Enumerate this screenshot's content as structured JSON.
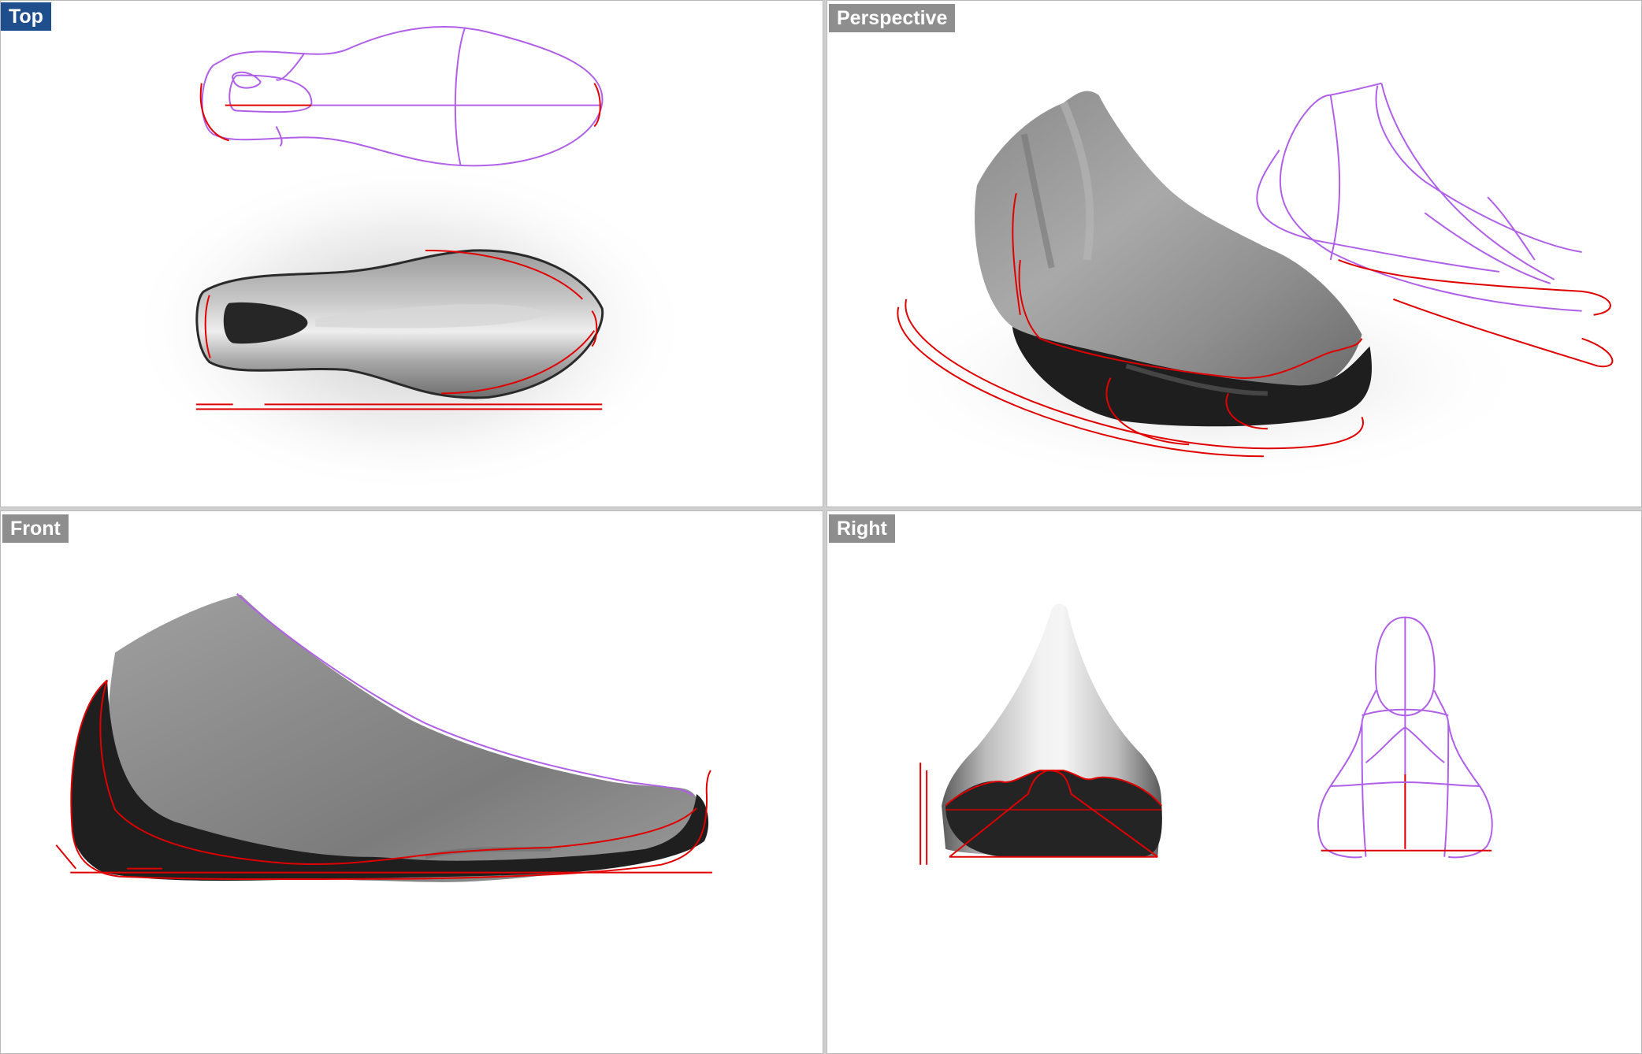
{
  "viewports": {
    "top": {
      "label": "Top",
      "active": true
    },
    "perspective": {
      "label": "Perspective",
      "active": false
    },
    "front": {
      "label": "Front",
      "active": false
    },
    "right": {
      "label": "Right",
      "active": false
    }
  },
  "colors": {
    "active_label_bg": "#1f4e8c",
    "inactive_label_bg": "#8e8e8e",
    "curve_red": "#e00000",
    "curve_purple": "#b060e8",
    "surface_gray": "#8a8a8a",
    "sole_black": "#1e1e1e",
    "viewport_bg": "#ffffff"
  },
  "model": {
    "object": "shoe-last-surface",
    "curves": [
      "outline-curve",
      "centerline",
      "ground-line",
      "profile-curve"
    ]
  }
}
